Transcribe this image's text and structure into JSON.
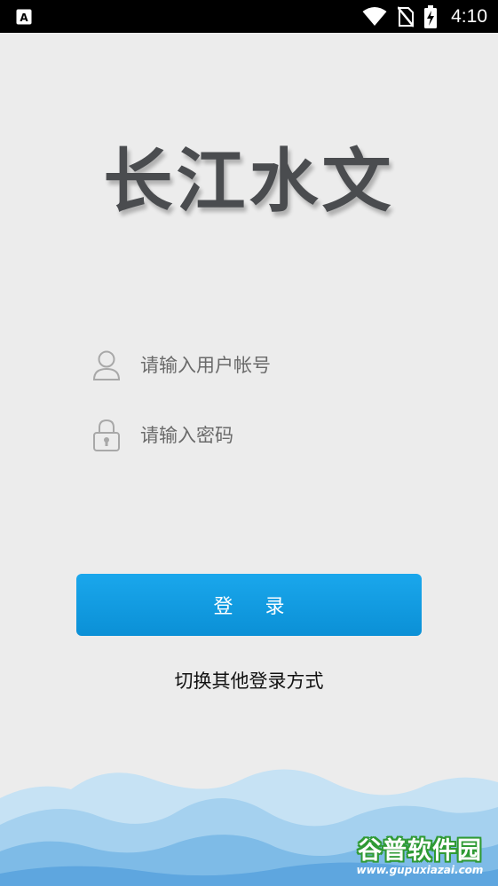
{
  "status_bar": {
    "time": "4:10",
    "icons": [
      "notification-a-icon",
      "wifi-icon",
      "no-sim-icon",
      "battery-charging-icon"
    ]
  },
  "app": {
    "logo_text": "长江水文"
  },
  "form": {
    "username": {
      "placeholder": "请输入用户帐号",
      "value": "",
      "icon": "user-icon"
    },
    "password": {
      "placeholder": "请输入密码",
      "value": "",
      "icon": "lock-icon"
    },
    "login_label": "登录",
    "switch_login_label": "切换其他登录方式"
  },
  "watermark": {
    "title": "谷普软件园",
    "url": "www.gupuxiazai.com"
  },
  "colors": {
    "background": "#ececec",
    "primary": "#1aa7ec",
    "logo": "#4a4c4f",
    "wave_light": "#c6e2f4",
    "wave_mid": "#93c8ec",
    "wave_dark": "#6fb2e4"
  }
}
